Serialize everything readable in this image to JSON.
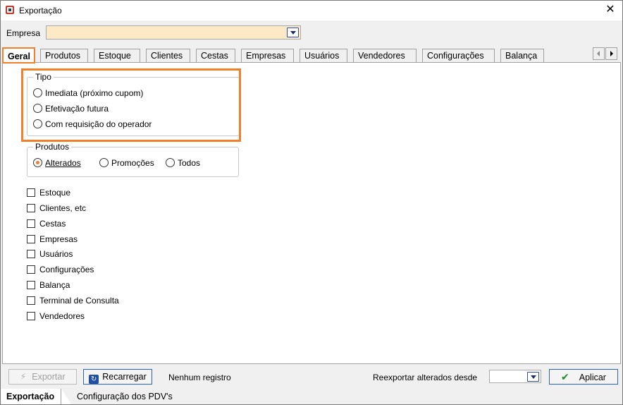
{
  "window": {
    "title": "Exportação",
    "close_glyph": "✕"
  },
  "empresa": {
    "label": "Empresa",
    "value": ""
  },
  "tabs": [
    {
      "label": "Geral",
      "active": true
    },
    {
      "label": "Produtos"
    },
    {
      "label": "Estoque"
    },
    {
      "label": "Clientes"
    },
    {
      "label": "Cestas"
    },
    {
      "label": "Empresas"
    },
    {
      "label": "Usuários"
    },
    {
      "label": "Vendedores"
    },
    {
      "label": "Configurações"
    },
    {
      "label": "Balança"
    }
  ],
  "tipo": {
    "title": "Tipo",
    "options": [
      {
        "label": "Imediata (próximo cupom)",
        "checked": false
      },
      {
        "label": "Efetivação futura",
        "checked": false
      },
      {
        "label": "Com requisição do operador",
        "checked": false
      }
    ]
  },
  "produtos": {
    "title": "Produtos",
    "options": [
      {
        "label": "Alterados",
        "checked": true
      },
      {
        "label": "Promoções",
        "checked": false
      },
      {
        "label": "Todos",
        "checked": false
      }
    ]
  },
  "checks": [
    {
      "label": "Estoque",
      "checked": false
    },
    {
      "label": "Clientes, etc",
      "checked": false
    },
    {
      "label": "Cestas",
      "checked": false
    },
    {
      "label": "Empresas",
      "checked": false
    },
    {
      "label": "Usuários",
      "checked": false
    },
    {
      "label": "Configurações",
      "checked": false
    },
    {
      "label": "Balança",
      "checked": false
    },
    {
      "label": "Terminal de Consulta",
      "checked": false
    },
    {
      "label": "Vendedores",
      "checked": false
    }
  ],
  "toolbar": {
    "exportar_label": "Exportar",
    "recarregar_label": "Recarregar",
    "status": "Nenhum registro",
    "reexport_label": "Reexportar alterados desde",
    "reexport_value": "",
    "aplicar_label": "Aplicar"
  },
  "bottom_tabs": [
    {
      "label": "Exportação",
      "active": true
    },
    {
      "label": "Configuração dos PDV's"
    }
  ],
  "colors": {
    "highlight": "#f07f2e",
    "combo_bg": "#fde9c6",
    "accent": "#2b63b8"
  }
}
